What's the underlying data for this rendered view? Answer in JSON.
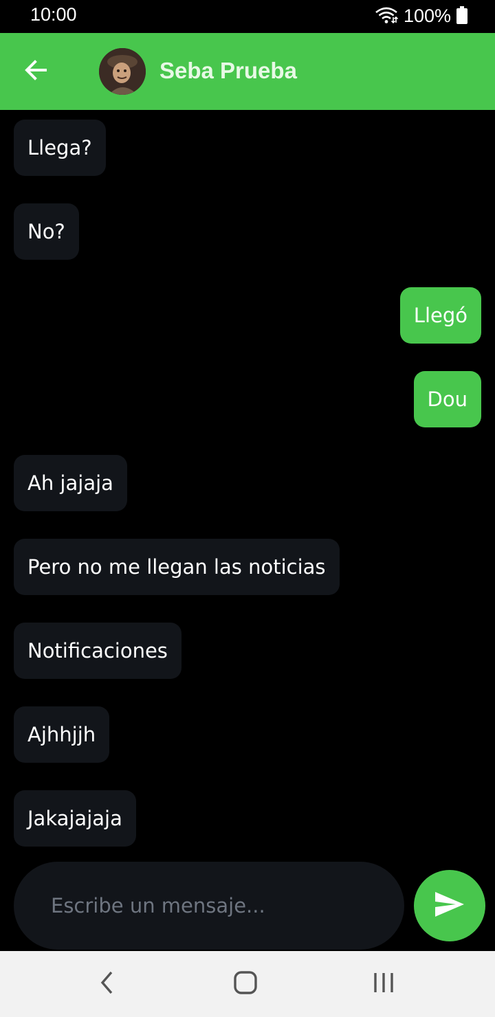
{
  "status_bar": {
    "time": "10:00",
    "battery": "100%",
    "icons": [
      "wifi-icon",
      "battery-icon"
    ]
  },
  "header": {
    "contact_name": "Seba Prueba",
    "back_icon": "arrow-left-icon",
    "color": "#48c64d"
  },
  "messages": [
    {
      "text": "Llega?",
      "direction": "incoming"
    },
    {
      "text": "No?",
      "direction": "incoming"
    },
    {
      "text": "Llegó",
      "direction": "outgoing"
    },
    {
      "text": "Dou",
      "direction": "outgoing"
    },
    {
      "text": "Ah jajaja",
      "direction": "incoming"
    },
    {
      "text": "Pero no me llegan las noticias",
      "direction": "incoming"
    },
    {
      "text": "Notificaciones",
      "direction": "incoming"
    },
    {
      "text": "Ajhhjjh",
      "direction": "incoming"
    },
    {
      "text": "Jakajajaja",
      "direction": "incoming"
    }
  ],
  "composer": {
    "placeholder": "Escribe un mensaje...",
    "value": "",
    "send_icon": "send-icon"
  },
  "nav_bar": {
    "icons": [
      "nav-back-icon",
      "nav-home-icon",
      "nav-recents-icon"
    ]
  },
  "colors": {
    "accent": "#48c64d",
    "incoming_bubble": "#12151a",
    "background": "#000000"
  }
}
